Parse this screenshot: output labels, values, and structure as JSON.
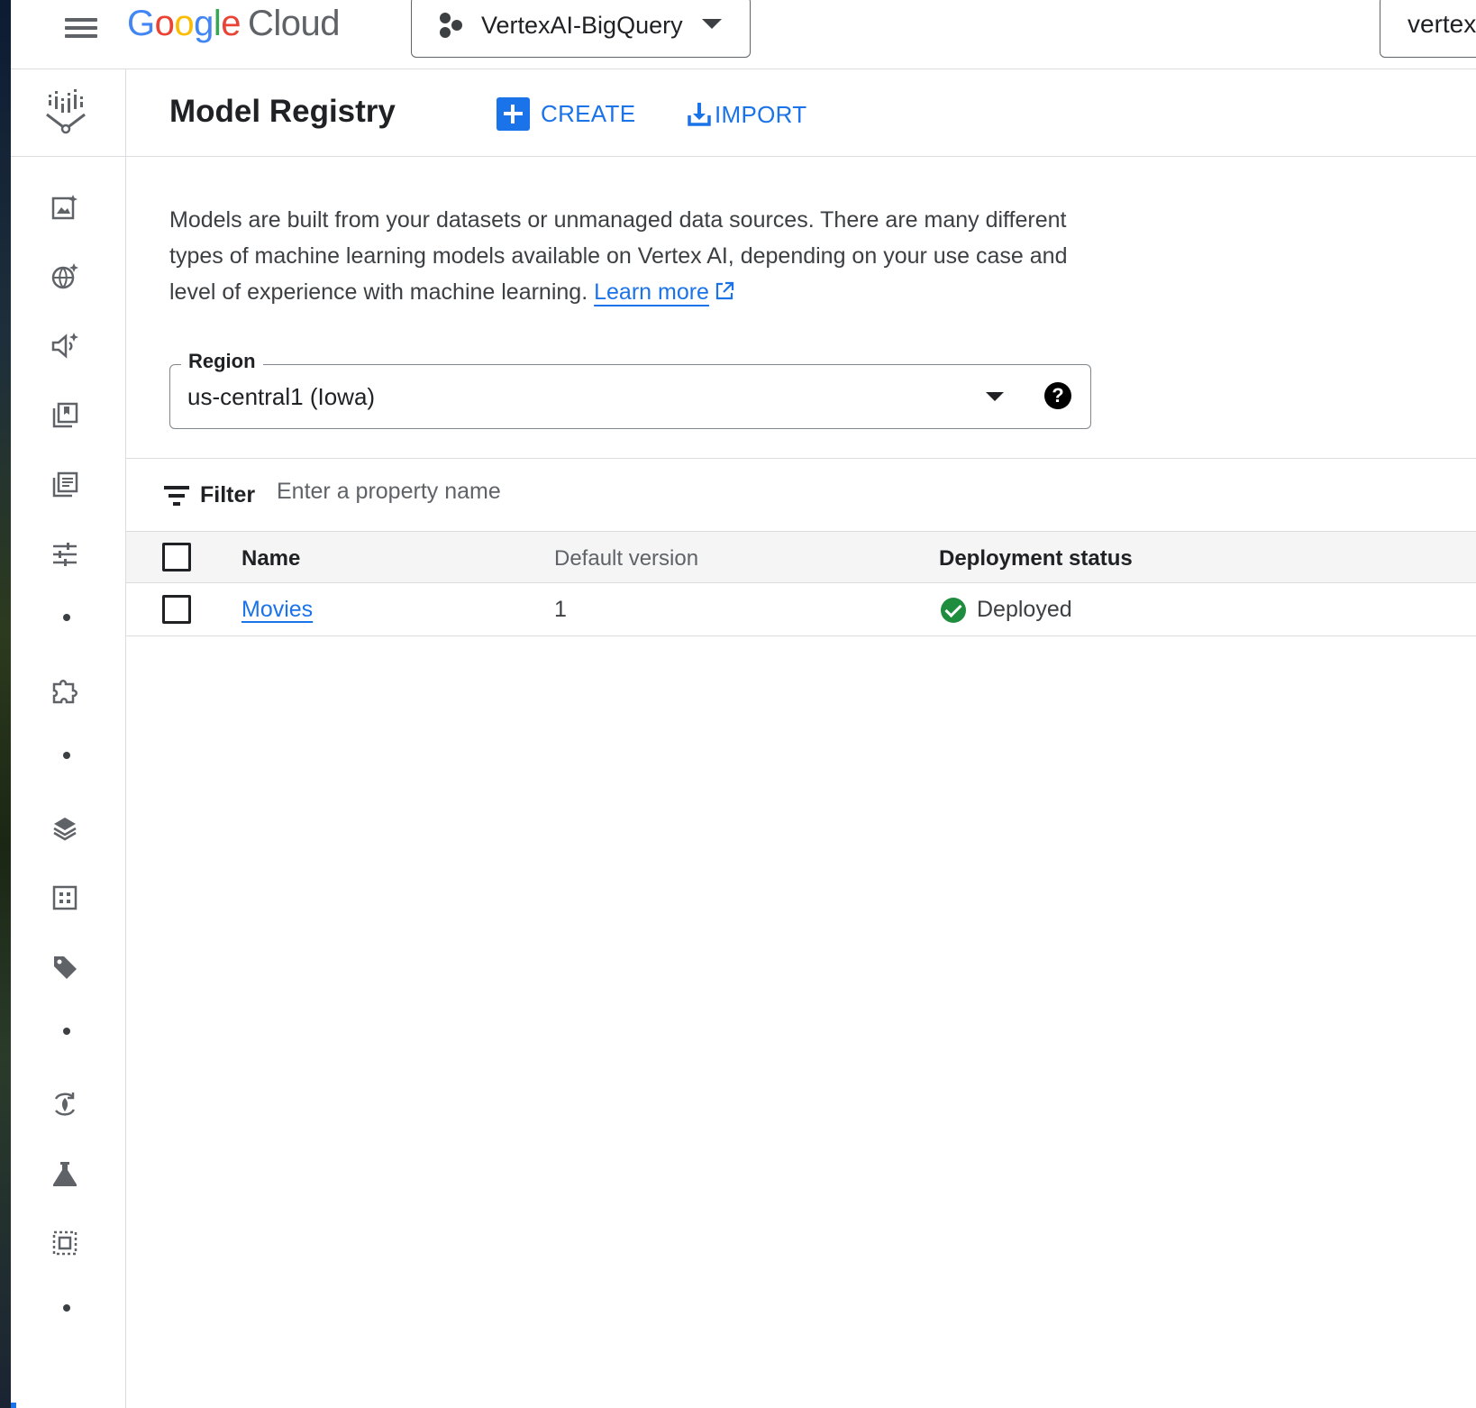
{
  "topbar": {
    "logo_letters": [
      "G",
      "o",
      "o",
      "g",
      "l",
      "e"
    ],
    "logo_product": "Cloud",
    "project_name": "VertexAI-BigQuery",
    "search_value": "vertex"
  },
  "sidebar": {
    "icons": [
      "vertex-ai-logo-icon",
      "image-sparkle-icon",
      "globe-sparkle-icon",
      "speaker-sparkle-icon",
      "collections-icon",
      "document-list-icon",
      "tune-sliders-icon",
      "dot-separator",
      "puzzle-piece-icon",
      "dot-separator",
      "layers-icon",
      "grid-icon",
      "tag-icon",
      "dot-separator",
      "deploy-target-icon",
      "flask-icon",
      "selection-box-icon",
      "dot-separator"
    ]
  },
  "header": {
    "title": "Model Registry",
    "create_label": "CREATE",
    "import_label": "IMPORT"
  },
  "intro": {
    "text": "Models are built from your datasets or unmanaged data sources. There are many different types of machine learning models available on Vertex AI, depending on your use case and level of experience with machine learning.",
    "link_label": "Learn more"
  },
  "region": {
    "label": "Region",
    "value": "us-central1 (Iowa)",
    "help": "?"
  },
  "filter": {
    "label": "Filter",
    "placeholder": "Enter a property name"
  },
  "table": {
    "columns": [
      "Name",
      "Default version",
      "Deployment status"
    ],
    "rows": [
      {
        "name": "Movies",
        "default_version": "1",
        "deployment_status": "Deployed"
      }
    ]
  },
  "colors": {
    "accent": "#1a73e8",
    "status_ok": "#1e8e3e",
    "border": "#dadce0"
  }
}
